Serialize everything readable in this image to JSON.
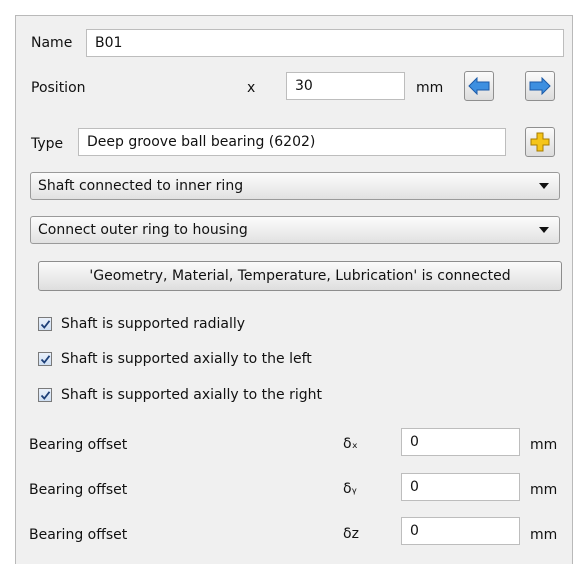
{
  "name": {
    "label": "Name",
    "value": "B01"
  },
  "position": {
    "label": "Position",
    "axis": "x",
    "value": "30",
    "unit": "mm",
    "icons": {
      "left": "arrow-left-icon",
      "right": "arrow-right-icon"
    }
  },
  "type": {
    "label": "Type",
    "value": "Deep groove ball bearing (6202)",
    "icon": "plus-icon"
  },
  "inner_ring_select": {
    "value": "Shaft connected to inner ring"
  },
  "outer_ring_select": {
    "value": "Connect outer ring to housing"
  },
  "connect_button": {
    "label": "'Geometry, Material, Temperature, Lubrication' is connected"
  },
  "checkboxes": [
    {
      "label": "Shaft is supported radially",
      "checked": true
    },
    {
      "label": "Shaft is supported axially to the left",
      "checked": true
    },
    {
      "label": "Shaft is supported axially to the right",
      "checked": true
    }
  ],
  "offsets": [
    {
      "label": "Bearing offset",
      "symbol": "δₓ",
      "value": "0",
      "unit": "mm"
    },
    {
      "label": "Bearing offset",
      "symbol": "δᵧ",
      "value": "0",
      "unit": "mm"
    },
    {
      "label": "Bearing offset",
      "symbol": "δz",
      "value": "0",
      "unit": "mm"
    }
  ],
  "colors": {
    "panel": "#f0f0f0",
    "arrow_blue": "#3d8fe0",
    "plus_yellow": "#f5c518"
  }
}
